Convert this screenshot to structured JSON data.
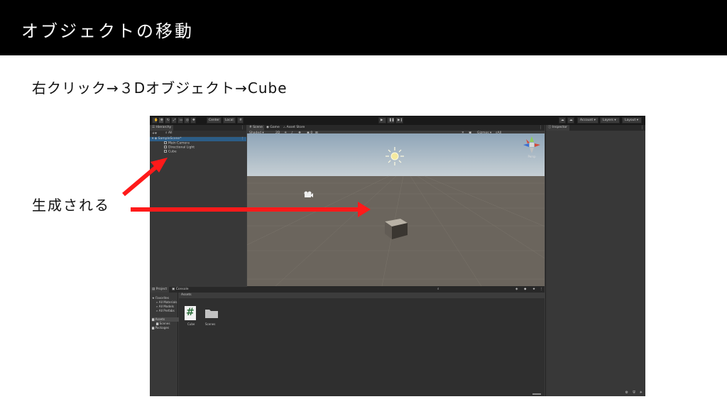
{
  "slide": {
    "title": "オブジェクトの移動",
    "instruction": "右クリック→３Dオブジェクト→Cube",
    "note": "生成される"
  },
  "toolbar": {
    "center_label": "Center",
    "local_label": "Local",
    "account_label": "Account",
    "layers_label": "Layers",
    "layout_label": "Layout"
  },
  "hierarchy": {
    "tab_label": "Hierarchy",
    "search_placeholder": "All",
    "scene_name": "SampleScene*",
    "items": [
      "Main Camera",
      "Directional Light",
      "Cube"
    ]
  },
  "scene_tabs": [
    "Scene",
    "Game",
    "Asset Store"
  ],
  "scene_toolbar": {
    "shading": "Shaded",
    "mode_2d": "2D",
    "gizmos": "Gizmos",
    "search_placeholder": "All",
    "persp": "Persp"
  },
  "inspector": {
    "tab_label": "Inspector"
  },
  "project": {
    "tabs": [
      "Project",
      "Console"
    ],
    "favorites_label": "Favorites",
    "favorites": [
      "All Materials",
      "All Models",
      "All Prefabs"
    ],
    "assets_label": "Assets",
    "asset_children": [
      "Scenes"
    ],
    "packages_label": "Packages",
    "breadcrumb": "Assets",
    "assets": [
      {
        "name": "Cube",
        "icon": "csharp-script-icon"
      },
      {
        "name": "Scenes",
        "icon": "folder-icon"
      }
    ]
  },
  "colors": {
    "arrow": "#ff1a1a",
    "editor_bg": "#383838",
    "titlebar_bg": "#000000"
  }
}
